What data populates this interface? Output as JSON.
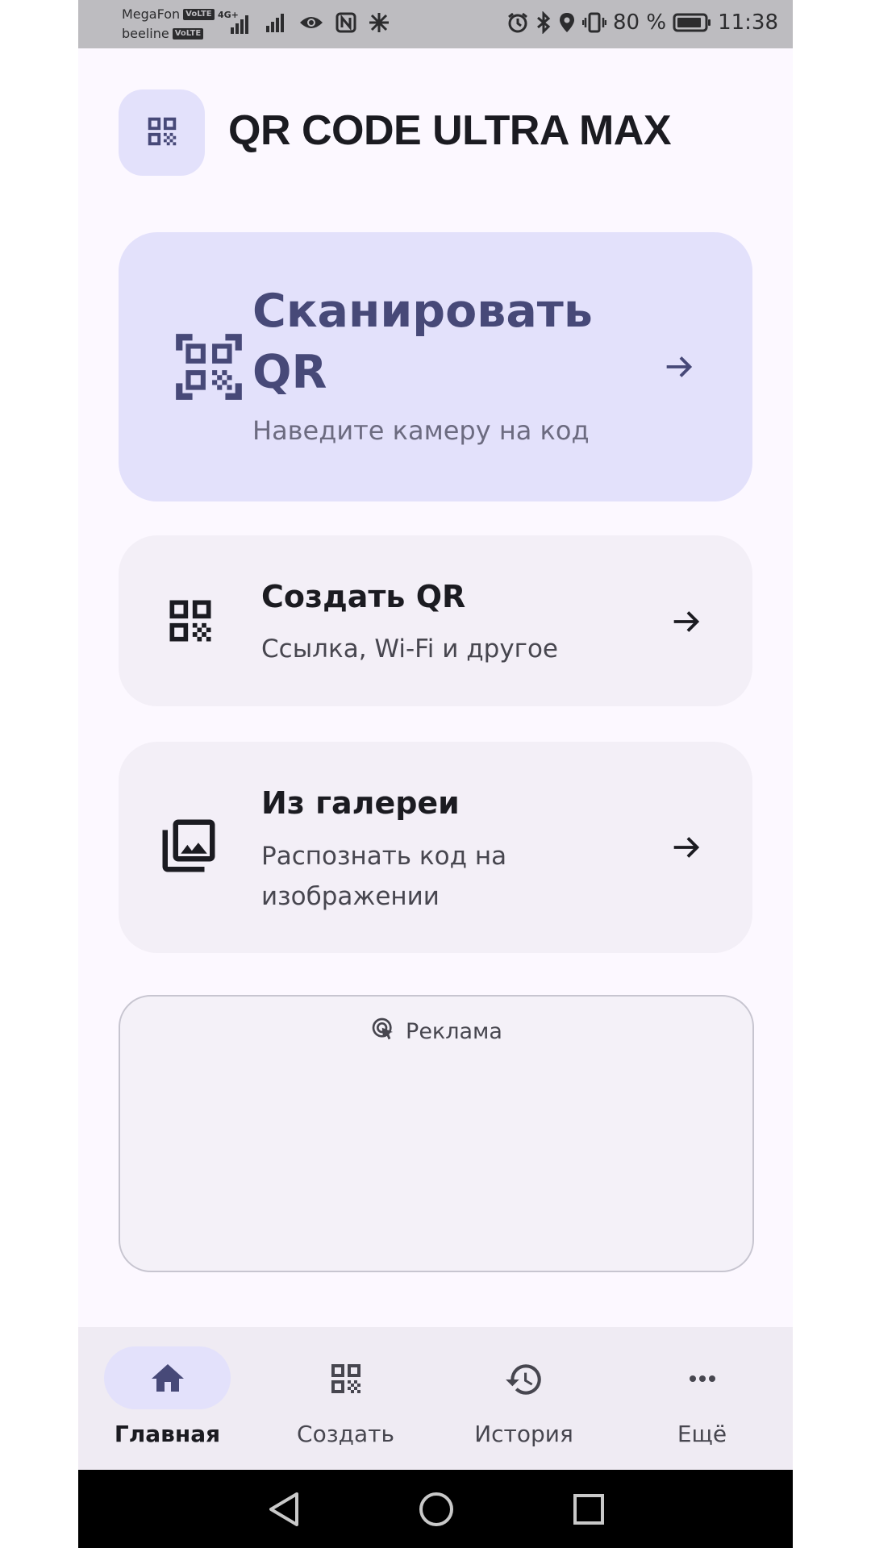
{
  "status_bar": {
    "carrier_1": "MegaFon",
    "carrier_2": "beeline",
    "volte_1": "VoLTE",
    "volte_2": "VoLTE",
    "network_type": "4G+",
    "battery_percent": "80 %",
    "time": "11:38"
  },
  "header": {
    "title": "QR CODE ULTRA MAX",
    "logo_icon": "qr-code-icon"
  },
  "cards": {
    "scan": {
      "title": "Сканировать QR",
      "subtitle": "Наведите камеру на код",
      "icon": "qr-scan-icon"
    },
    "create": {
      "title": "Создать QR",
      "subtitle": "Ссылка, Wi-Fi и другое",
      "icon": "qr-code-icon"
    },
    "gallery": {
      "title": "Из галереи",
      "subtitle": "Распознать код на изображении",
      "icon": "photo-library-icon"
    }
  },
  "ad": {
    "label": "Реклама",
    "icon": "ad-cursor-icon"
  },
  "bottom_nav": [
    {
      "label": "Главная",
      "icon": "home-icon",
      "active": true
    },
    {
      "label": "Создать",
      "icon": "qr-code-icon",
      "active": false
    },
    {
      "label": "История",
      "icon": "history-icon",
      "active": false
    },
    {
      "label": "Ещё",
      "icon": "more-icon",
      "active": false
    }
  ],
  "colors": {
    "accent_container": "#e3e1fb",
    "accent_text": "#474978",
    "surface": "#fcf8ff",
    "card_surface": "#f3eff7"
  }
}
